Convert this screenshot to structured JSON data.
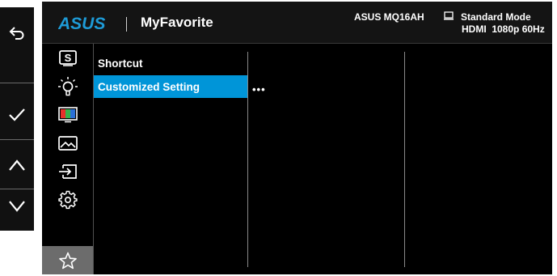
{
  "keys": {
    "back": "back-icon",
    "confirm": "checkmark-icon",
    "up": "chevron-up-icon",
    "down": "chevron-down-icon"
  },
  "header": {
    "logo_text": "ASUS",
    "title": "MyFavorite",
    "model": "ASUS MQ16AH",
    "mode": "Standard Mode",
    "input_info": "HDMI  1080p 60Hz"
  },
  "categories": [
    {
      "name": "splendid",
      "icon": "splendid-s-icon"
    },
    {
      "name": "eye-care",
      "icon": "bulb-icon"
    },
    {
      "name": "color",
      "icon": "color-bars-icon"
    },
    {
      "name": "image",
      "icon": "image-icon"
    },
    {
      "name": "input-select",
      "icon": "input-arrow-icon"
    },
    {
      "name": "system-setup",
      "icon": "gear-icon"
    },
    {
      "name": "myfavorite",
      "icon": "star-icon",
      "selected": true
    }
  ],
  "menu": {
    "items": [
      {
        "label": "Shortcut"
      },
      {
        "label": "Customized Setting",
        "highlighted": true
      }
    ]
  },
  "submenu": {
    "value": "•••"
  },
  "colors": {
    "accent": "#0095d8",
    "selected_bg": "#6c6c6c",
    "background": "#000000"
  }
}
